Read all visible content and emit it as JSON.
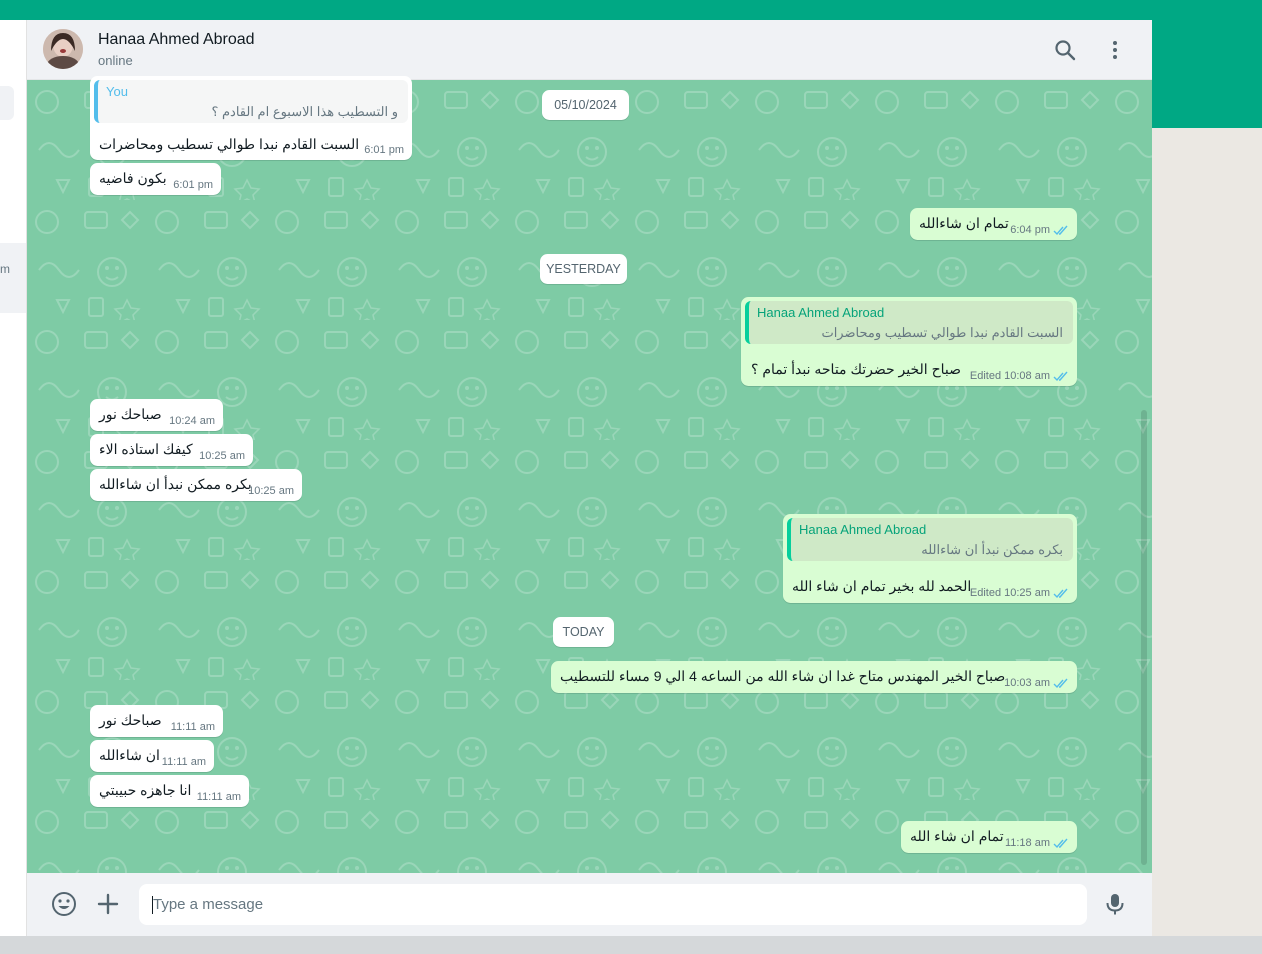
{
  "header": {
    "contact_name": "Hanaa Ahmed Abroad",
    "status": "online",
    "search_icon": "search-icon",
    "menu_icon": "more-vertical-icon"
  },
  "sidebar": {
    "fragment": "m"
  },
  "dates": {
    "d1": "05/10/2024",
    "d2": "YESTERDAY",
    "d3": "TODAY"
  },
  "messages": [
    {
      "dir": "in",
      "quote_name": "You",
      "quote_text": "و التسطيب هذا الاسبوع ام القادم ؟",
      "text": "السبت القادم نبدا طوالي تسطيب ومحاضرات",
      "time": "6:01 pm"
    },
    {
      "dir": "in",
      "text": "بكون فاضيه",
      "time": "6:01 pm"
    },
    {
      "dir": "out",
      "text": "تمام ان شاءالله",
      "time": "6:04 pm"
    },
    {
      "dir": "out",
      "quote_name": "Hanaa Ahmed Abroad",
      "quote_text": "السبت القادم نبدا طوالي تسطيب ومحاضرات",
      "text": "صباح الخير حضرتك متاحه نبدأ تمام ؟",
      "time": "Edited 10:08 am"
    },
    {
      "dir": "in",
      "text": "صباحك نور",
      "time": "10:24 am"
    },
    {
      "dir": "in",
      "text": "كيفك استاذه الاء",
      "time": "10:25 am"
    },
    {
      "dir": "in",
      "text": "بكره ممكن نبدأ ان شاءالله",
      "time": "10:25 am"
    },
    {
      "dir": "out",
      "quote_name": "Hanaa Ahmed Abroad",
      "quote_text": "بكره ممكن نبدأ ان شاءالله",
      "text": "الحمد لله بخير تمام ان شاء الله",
      "time": "Edited 10:25 am"
    },
    {
      "dir": "out",
      "text": "صباح الخير المهندس متاح غدا ان شاء الله من الساعه 4 الي 9 مساء للتسطيب",
      "time": "10:03 am"
    },
    {
      "dir": "in",
      "text": "صباحك نور",
      "time": "11:11 am"
    },
    {
      "dir": "in",
      "text": "ان شاءالله",
      "time": "11:11 am"
    },
    {
      "dir": "in",
      "text": "انا جاهزه حبيبتي",
      "time": "11:11 am"
    },
    {
      "dir": "out",
      "text": "تمام ان شاء الله",
      "time": "11:18 am"
    }
  ],
  "composer": {
    "placeholder": "Type a message",
    "emoji_icon": "emoji-icon",
    "attach_icon": "plus-icon",
    "mic_icon": "mic-icon"
  },
  "colors": {
    "brand": "#00a884",
    "wallpaper": "#7ecba5",
    "outgoing_bubble": "#d9fdd3",
    "incoming_bubble": "#ffffff",
    "read_tick": "#53bdeb"
  }
}
